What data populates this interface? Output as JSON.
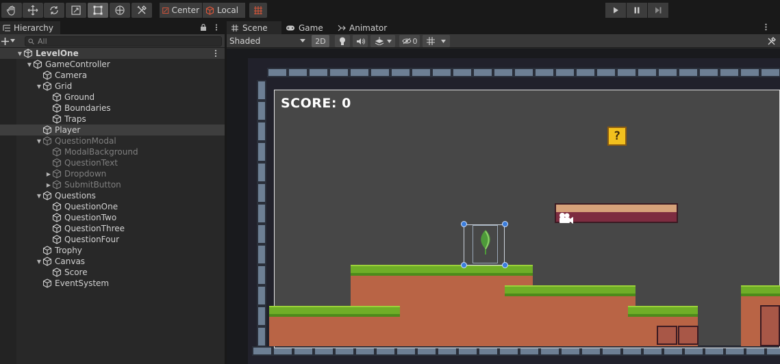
{
  "toolbar": {
    "tools": [
      "hand-tool",
      "move-tool",
      "rotate-tool",
      "scale-tool",
      "rect-tool",
      "transform-tool",
      "custom-tool"
    ],
    "active_tool": "rect-tool",
    "pivot_label": "Center",
    "space_label": "Local",
    "playback": [
      "play",
      "pause",
      "step"
    ]
  },
  "hierarchy": {
    "tab_label": "Hierarchy",
    "search_placeholder": "All",
    "scene_name": "LevelOne",
    "items": [
      {
        "label": "GameController",
        "depth": 1,
        "arrow": "open",
        "dim": false
      },
      {
        "label": "Camera",
        "depth": 2,
        "arrow": "",
        "dim": false
      },
      {
        "label": "Grid",
        "depth": 2,
        "arrow": "open",
        "dim": false
      },
      {
        "label": "Ground",
        "depth": 3,
        "arrow": "",
        "dim": false
      },
      {
        "label": "Boundaries",
        "depth": 3,
        "arrow": "",
        "dim": false
      },
      {
        "label": "Traps",
        "depth": 3,
        "arrow": "",
        "dim": false
      },
      {
        "label": "Player",
        "depth": 2,
        "arrow": "",
        "dim": false,
        "selected": true
      },
      {
        "label": "QuestionModal",
        "depth": 2,
        "arrow": "open",
        "dim": true
      },
      {
        "label": "ModalBackground",
        "depth": 3,
        "arrow": "",
        "dim": true
      },
      {
        "label": "QuestionText",
        "depth": 3,
        "arrow": "",
        "dim": true
      },
      {
        "label": "Dropdown",
        "depth": 3,
        "arrow": "closed",
        "dim": true
      },
      {
        "label": "SubmitButton",
        "depth": 3,
        "arrow": "closed",
        "dim": true
      },
      {
        "label": "Questions",
        "depth": 2,
        "arrow": "open",
        "dim": false
      },
      {
        "label": "QuestionOne",
        "depth": 3,
        "arrow": "",
        "dim": false
      },
      {
        "label": "QuestionTwo",
        "depth": 3,
        "arrow": "",
        "dim": false
      },
      {
        "label": "QuestionThree",
        "depth": 3,
        "arrow": "",
        "dim": false
      },
      {
        "label": "QuestionFour",
        "depth": 3,
        "arrow": "",
        "dim": false
      },
      {
        "label": "Trophy",
        "depth": 2,
        "arrow": "",
        "dim": false
      },
      {
        "label": "Canvas",
        "depth": 2,
        "arrow": "open",
        "dim": false
      },
      {
        "label": "Score",
        "depth": 3,
        "arrow": "",
        "dim": false
      },
      {
        "label": "EventSystem",
        "depth": 2,
        "arrow": "",
        "dim": false
      }
    ]
  },
  "scene": {
    "tabs": [
      "Scene",
      "Game",
      "Animator"
    ],
    "active_tab": "Scene",
    "shading_mode": "Shaded",
    "mode_2d_label": "2D",
    "hidden_count": "0",
    "score_text": "SCORE: 0",
    "qblock_glyph": "?"
  }
}
